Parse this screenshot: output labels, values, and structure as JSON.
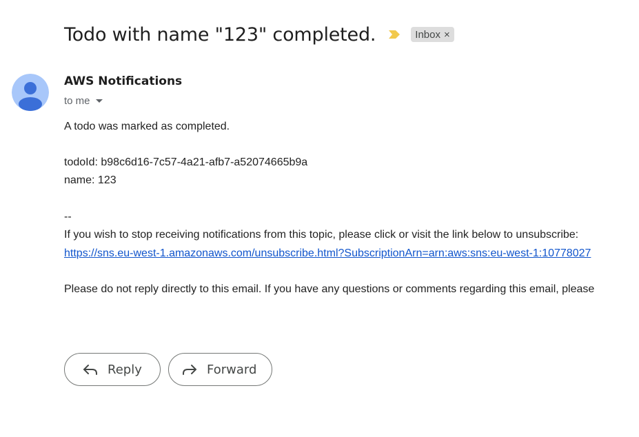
{
  "email": {
    "subject": "Todo with name \"123\" completed.",
    "label_chip": "Inbox",
    "label_remove": "×",
    "sender_name": "AWS Notifications",
    "recipient": "to me",
    "body": {
      "line1": "A todo was marked as completed.",
      "line2": "todoId: b98c6d16-7c57-4a21-afb7-a52074665b9a",
      "line3": "name: 123",
      "separator": "--",
      "unsubscribe_text": "If you wish to stop receiving notifications from this topic, please click or visit the link below to unsubscribe:",
      "unsubscribe_link": "https://sns.eu-west-1.amazonaws.com/unsubscribe.html?SubscriptionArn=arn:aws:sns:eu-west-1:10778027",
      "footer": "Please do not reply directly to this email. If you have any questions or comments regarding this email, please"
    }
  },
  "actions": {
    "reply_label": "Reply",
    "forward_label": "Forward"
  },
  "icons": {
    "importance": "importance-marker-icon",
    "avatar": "default-avatar-icon",
    "reply": "reply-arrow-icon",
    "forward": "forward-arrow-icon"
  },
  "colors": {
    "importance": "#f2c94c",
    "avatar_bg": "#a8c7fa",
    "avatar_fg": "#3b6fd8",
    "link": "#1155cc"
  }
}
